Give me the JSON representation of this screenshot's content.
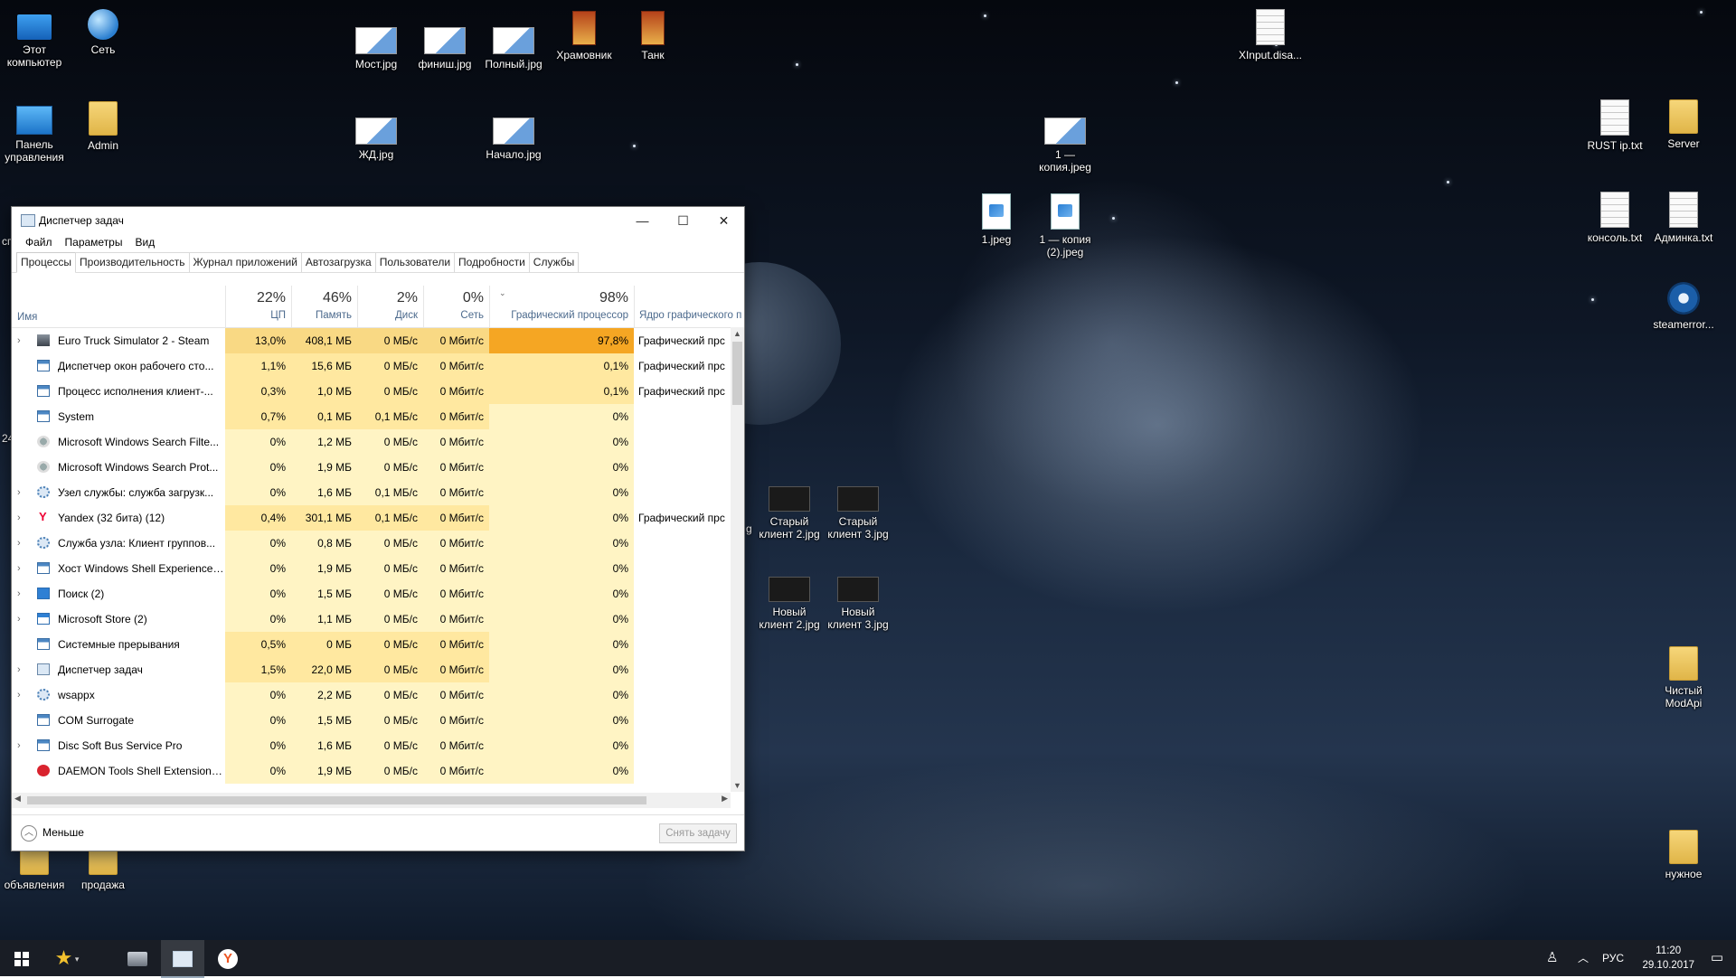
{
  "desktop": {
    "icons": [
      {
        "label": "Этот компьютер",
        "icon": "computer-icon"
      },
      {
        "label": "Сеть",
        "icon": "network-icon"
      },
      {
        "label": "Мост.jpg",
        "icon": "image-file-icon"
      },
      {
        "label": "финиш.jpg",
        "icon": "image-file-icon"
      },
      {
        "label": "Полный.jpg",
        "icon": "image-file-icon"
      },
      {
        "label": "Храмовник",
        "icon": "game-shortcut-icon"
      },
      {
        "label": "Танк",
        "icon": "game-shortcut-icon"
      },
      {
        "label": "XInput.disa...",
        "icon": "text-file-icon"
      },
      {
        "label": "Панель управления",
        "icon": "control-panel-icon"
      },
      {
        "label": "Admin",
        "icon": "user-folder-icon"
      },
      {
        "label": "ЖД.jpg",
        "icon": "image-file-icon"
      },
      {
        "label": "Начало.jpg",
        "icon": "image-file-icon"
      },
      {
        "label": "1 — копия.jpeg",
        "icon": "image-file-icon"
      },
      {
        "label": "RUST ip.txt",
        "icon": "text-file-icon"
      },
      {
        "label": "Server",
        "icon": "folder-icon"
      },
      {
        "label": "1.jpeg",
        "icon": "photo-file-icon"
      },
      {
        "label": "1 — копия (2).jpeg",
        "icon": "photo-file-icon"
      },
      {
        "label": "консоль.txt",
        "icon": "text-file-icon"
      },
      {
        "label": "Админка.txt",
        "icon": "text-file-icon"
      },
      {
        "label": "steamerror...",
        "icon": "steam-icon"
      },
      {
        "label": "Старый клиент 2.jpg",
        "icon": "dark-image-icon"
      },
      {
        "label": "Старый клиент 3.jpg",
        "icon": "dark-image-icon"
      },
      {
        "label": "Новый клиент 2.jpg",
        "icon": "dark-image-icon"
      },
      {
        "label": "Новый клиент 3.jpg",
        "icon": "dark-image-icon"
      },
      {
        "label": "Чистый ModApi",
        "icon": "folder-icon"
      },
      {
        "label": "объявления",
        "icon": "folder-icon"
      },
      {
        "label": "продажа",
        "icon": "folder-icon"
      },
      {
        "label": "нужное",
        "icon": "folder-icon"
      }
    ],
    "partial_labels": {
      "left_edge_1": "сг",
      "left_edge_2": "24",
      "left_edge_3": "g"
    }
  },
  "taskmanager": {
    "title": "Диспетчер задач",
    "controls": {
      "minimize": "—",
      "maximize": "☐",
      "close": "✕"
    },
    "menu": [
      "Файл",
      "Параметры",
      "Вид"
    ],
    "tabs": [
      "Процессы",
      "Производительность",
      "Журнал приложений",
      "Автозагрузка",
      "Пользователи",
      "Подробности",
      "Службы"
    ],
    "active_tab": 0,
    "columns": {
      "name": "Имя",
      "cpu": {
        "pct": "22%",
        "label": "ЦП"
      },
      "mem": {
        "pct": "46%",
        "label": "Память"
      },
      "disk": {
        "pct": "2%",
        "label": "Диск"
      },
      "net": {
        "pct": "0%",
        "label": "Сеть"
      },
      "gpu": {
        "pct": "98%",
        "label": "Графический процессор"
      },
      "engine": {
        "label": "Ядро графического п"
      }
    },
    "rows": [
      {
        "name": "Euro Truck Simulator 2 - Steam",
        "expand": true,
        "icon": "truck-icon",
        "cpu": "13,0%",
        "mem": "408,1 МБ",
        "disk": "0 МБ/с",
        "net": "0 Мбит/с",
        "gpu": "97,8%",
        "engine": "Графический прс",
        "heat": 3,
        "gpuHeat": "heatgpu"
      },
      {
        "name": "Диспетчер окон рабочего сто...",
        "expand": false,
        "icon": "window-icon",
        "cpu": "1,1%",
        "mem": "15,6 МБ",
        "disk": "0 МБ/с",
        "net": "0 Мбит/с",
        "gpu": "0,1%",
        "engine": "Графический прс",
        "heat": 2,
        "gpuHeat": "heat2"
      },
      {
        "name": "Процесс исполнения клиент-...",
        "expand": false,
        "icon": "window-icon",
        "cpu": "0,3%",
        "mem": "1,0 МБ",
        "disk": "0 МБ/с",
        "net": "0 Мбит/с",
        "gpu": "0,1%",
        "engine": "Графический прс",
        "heat": 2,
        "gpuHeat": "heat2"
      },
      {
        "name": "System",
        "expand": false,
        "icon": "window-icon",
        "cpu": "0,7%",
        "mem": "0,1 МБ",
        "disk": "0,1 МБ/с",
        "net": "0 Мбит/с",
        "gpu": "0%",
        "engine": "",
        "heat": 2,
        "gpuHeat": "heat1"
      },
      {
        "name": "Microsoft Windows Search Filte...",
        "expand": false,
        "icon": "search-user-icon",
        "cpu": "0%",
        "mem": "1,2 МБ",
        "disk": "0 МБ/с",
        "net": "0 Мбит/с",
        "gpu": "0%",
        "engine": "",
        "heat": 1,
        "gpuHeat": "heat1"
      },
      {
        "name": "Microsoft Windows Search Prot...",
        "expand": false,
        "icon": "search-user-icon",
        "cpu": "0%",
        "mem": "1,9 МБ",
        "disk": "0 МБ/с",
        "net": "0 Мбит/с",
        "gpu": "0%",
        "engine": "",
        "heat": 1,
        "gpuHeat": "heat1"
      },
      {
        "name": "Узел службы: служба загрузк...",
        "expand": true,
        "icon": "gear-icon",
        "cpu": "0%",
        "mem": "1,6 МБ",
        "disk": "0,1 МБ/с",
        "net": "0 Мбит/с",
        "gpu": "0%",
        "engine": "",
        "heat": 1,
        "gpuHeat": "heat1"
      },
      {
        "name": "Yandex (32 бита) (12)",
        "expand": true,
        "icon": "yandex-icon",
        "cpu": "0,4%",
        "mem": "301,1 МБ",
        "disk": "0,1 МБ/с",
        "net": "0 Мбит/с",
        "gpu": "0%",
        "engine": "Графический прс",
        "heat": 2,
        "gpuHeat": "heat1"
      },
      {
        "name": "Служба узла: Клиент группов...",
        "expand": true,
        "icon": "gear-icon",
        "cpu": "0%",
        "mem": "0,8 МБ",
        "disk": "0 МБ/с",
        "net": "0 Мбит/с",
        "gpu": "0%",
        "engine": "",
        "heat": 1,
        "gpuHeat": "heat1"
      },
      {
        "name": "Хост Windows Shell Experience ...",
        "expand": true,
        "icon": "window-icon",
        "cpu": "0%",
        "mem": "1,9 МБ",
        "disk": "0 МБ/с",
        "net": "0 Мбит/с",
        "gpu": "0%",
        "engine": "",
        "heat": 1,
        "gpuHeat": "heat1"
      },
      {
        "name": "Поиск (2)",
        "expand": true,
        "icon": "search-icon",
        "cpu": "0%",
        "mem": "1,5 МБ",
        "disk": "0 МБ/с",
        "net": "0 Мбит/с",
        "gpu": "0%",
        "engine": "",
        "heat": 1,
        "gpuHeat": "heat1"
      },
      {
        "name": "Microsoft Store (2)",
        "expand": true,
        "icon": "store-icon",
        "cpu": "0%",
        "mem": "1,1 МБ",
        "disk": "0 МБ/с",
        "net": "0 Мбит/с",
        "gpu": "0%",
        "engine": "",
        "heat": 1,
        "gpuHeat": "heat1"
      },
      {
        "name": "Системные прерывания",
        "expand": false,
        "icon": "window-icon",
        "cpu": "0,5%",
        "mem": "0 МБ",
        "disk": "0 МБ/с",
        "net": "0 Мбит/с",
        "gpu": "0%",
        "engine": "",
        "heat": 2,
        "gpuHeat": "heat1"
      },
      {
        "name": "Диспетчер задач",
        "expand": true,
        "icon": "taskmgr-icon",
        "cpu": "1,5%",
        "mem": "22,0 МБ",
        "disk": "0 МБ/с",
        "net": "0 Мбит/с",
        "gpu": "0%",
        "engine": "",
        "heat": 2,
        "gpuHeat": "heat1"
      },
      {
        "name": "wsappx",
        "expand": true,
        "icon": "gear-icon",
        "cpu": "0%",
        "mem": "2,2 МБ",
        "disk": "0 МБ/с",
        "net": "0 Мбит/с",
        "gpu": "0%",
        "engine": "",
        "heat": 1,
        "gpuHeat": "heat1"
      },
      {
        "name": "COM Surrogate",
        "expand": false,
        "icon": "window-icon",
        "cpu": "0%",
        "mem": "1,5 МБ",
        "disk": "0 МБ/с",
        "net": "0 Мбит/с",
        "gpu": "0%",
        "engine": "",
        "heat": 1,
        "gpuHeat": "heat1"
      },
      {
        "name": "Disc Soft Bus Service Pro",
        "expand": true,
        "icon": "window-icon",
        "cpu": "0%",
        "mem": "1,6 МБ",
        "disk": "0 МБ/с",
        "net": "0 Мбит/с",
        "gpu": "0%",
        "engine": "",
        "heat": 1,
        "gpuHeat": "heat1"
      },
      {
        "name": "DAEMON Tools Shell Extensions...",
        "expand": false,
        "icon": "daemon-icon",
        "cpu": "0%",
        "mem": "1,9 МБ",
        "disk": "0 МБ/с",
        "net": "0 Мбит/с",
        "gpu": "0%",
        "engine": "",
        "heat": 1,
        "gpuHeat": "heat1"
      }
    ],
    "footer": {
      "less": "Меньше",
      "end_task": "Снять задачу"
    }
  },
  "taskbar": {
    "start": "windows-start-icon",
    "apps": [
      {
        "name": "favorites-star-icon",
        "active": false
      },
      {
        "name": "truck-game-icon",
        "active": false
      },
      {
        "name": "taskmgr-app-icon",
        "active": true
      },
      {
        "name": "yandex-browser-icon",
        "active": false
      }
    ],
    "language": "РУС",
    "time": "11:20",
    "date": "29.10.2017"
  }
}
